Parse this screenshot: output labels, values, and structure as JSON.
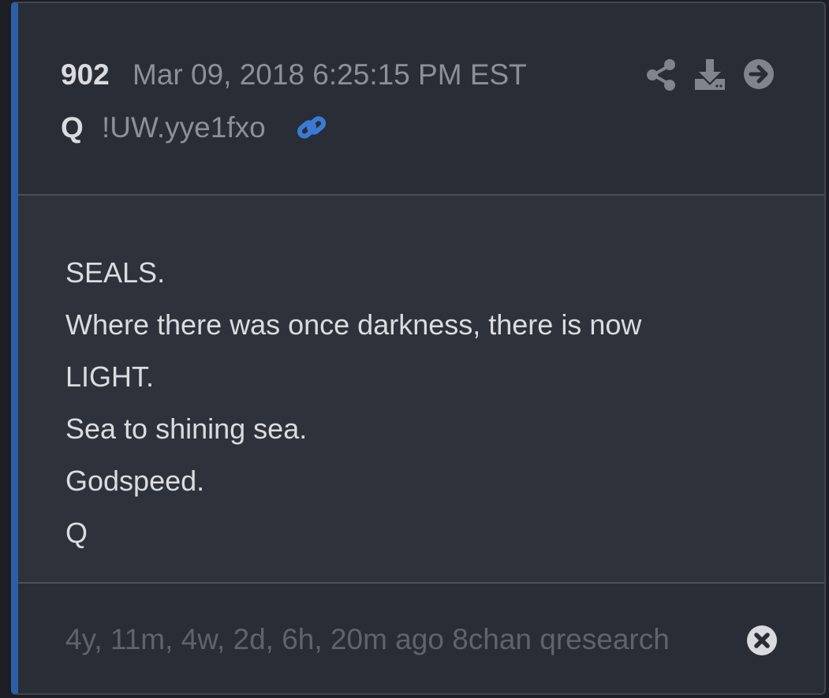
{
  "post": {
    "number": "902",
    "date": "Mar 09, 2018 6:25:15 PM EST",
    "author": "Q",
    "tripcode": "!UW.yye1fxo"
  },
  "actions": {
    "share_icon": "share-icon",
    "download_icon": "download-icon",
    "forward_icon": "arrow-right-circle-icon"
  },
  "body": {
    "lines": [
      "SEALS.",
      "Where there was once darkness, there is now",
      "LIGHT.",
      "Sea to shining sea.",
      "Godspeed.",
      "Q"
    ]
  },
  "footer": {
    "text": "4y, 11m, 4w, 2d, 6h, 20m ago 8chan qresearch"
  },
  "colors": {
    "accent": "#2e5fa6",
    "link": "#3a7bd5",
    "card_bg": "#2e323b",
    "text": "#dadcdf",
    "muted": "#8c9097"
  }
}
